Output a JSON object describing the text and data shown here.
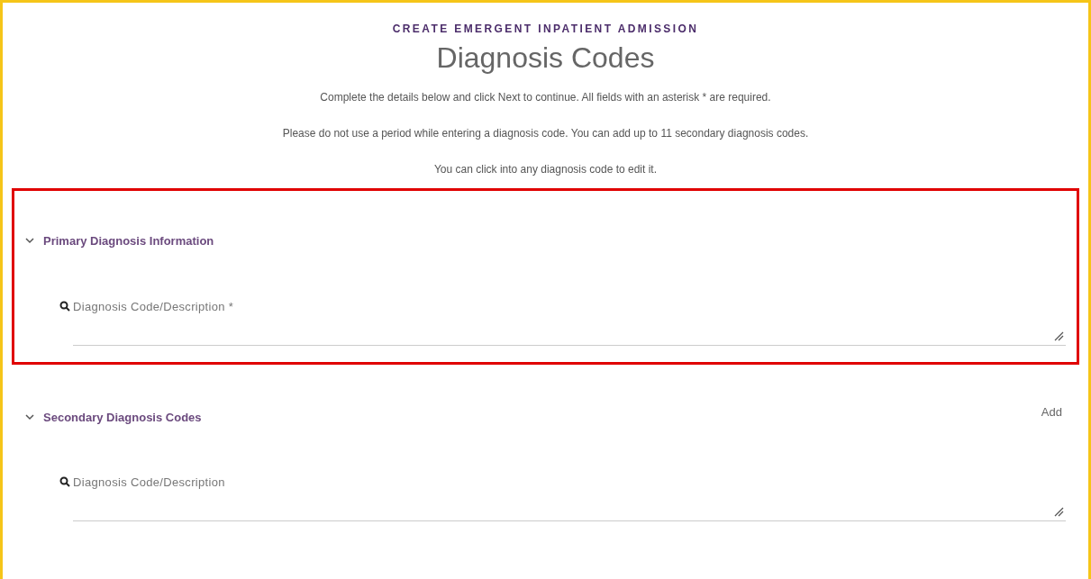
{
  "header": {
    "eyebrow": "CREATE EMERGENT INPATIENT ADMISSION",
    "title": "Diagnosis Codes",
    "instructions": [
      "Complete the details below and click Next to continue. All fields with an asterisk * are required.",
      "Please do not use a period while entering a diagnosis code. You can add up to 11 secondary diagnosis codes.",
      "You can click into any diagnosis code to edit it."
    ]
  },
  "sections": [
    {
      "title": "Primary Diagnosis Information",
      "expanded": true,
      "highlighted": true,
      "field": {
        "label": "Diagnosis Code/Description *"
      }
    },
    {
      "title": "Secondary Diagnosis Codes",
      "expanded": true,
      "highlighted": false,
      "action": "Add",
      "field": {
        "label": "Diagnosis Code/Description"
      }
    }
  ]
}
